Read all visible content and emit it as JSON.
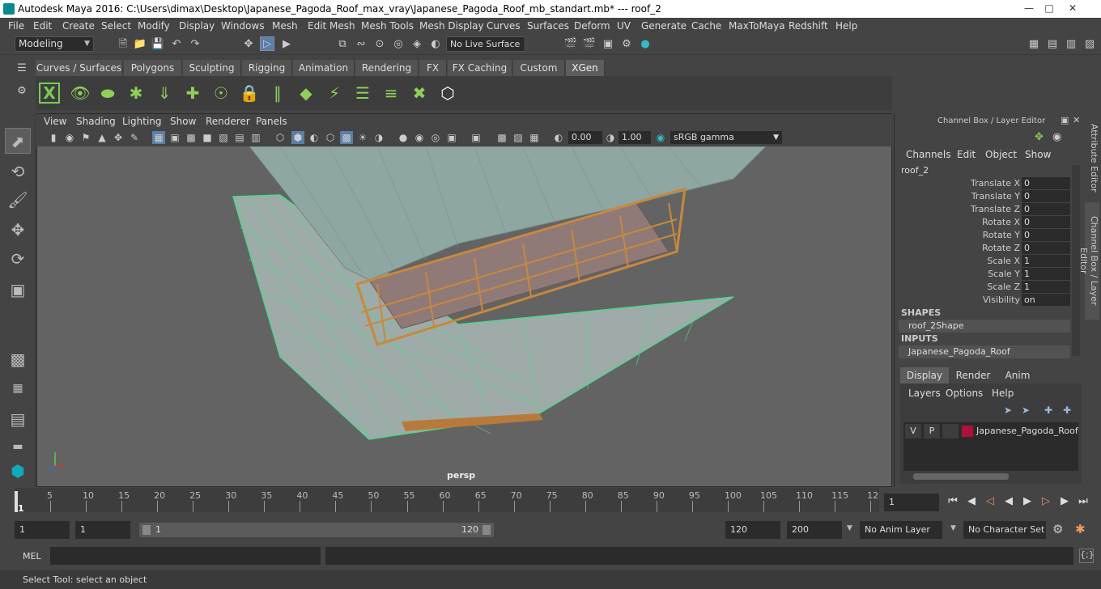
{
  "window": {
    "title": "Autodesk Maya 2016: C:\\Users\\dimax\\Desktop\\Japanese_Pagoda_Roof_max_vray\\Japanese_Pagoda_Roof_mb_standart.mb*   ---   roof_2"
  },
  "menubar": [
    "File",
    "Edit",
    "Create",
    "Select",
    "Modify",
    "Display",
    "Windows",
    "Mesh",
    "Edit Mesh",
    "Mesh Tools",
    "Mesh Display",
    "Curves",
    "Surfaces",
    "Deform",
    "UV",
    "Generate",
    "Cache",
    "MaxToMaya",
    "Redshift",
    "Help"
  ],
  "status": {
    "mode": "Modeling",
    "live_surface": "No Live Surface"
  },
  "shelf_tabs": [
    "Curves / Surfaces",
    "Polygons",
    "Sculpting",
    "Rigging",
    "Animation",
    "Rendering",
    "FX",
    "FX Caching",
    "Custom",
    "XGen"
  ],
  "shelf_active": "XGen",
  "viewport": {
    "menu": [
      "View",
      "Shading",
      "Lighting",
      "Show",
      "Renderer",
      "Panels"
    ],
    "exposure": "0.00",
    "gamma": "1.00",
    "colorspace": "sRGB gamma",
    "camera": "persp"
  },
  "channel_box": {
    "header": "Channel Box / Layer Editor",
    "menu": [
      "Channels",
      "Edit",
      "Object",
      "Show"
    ],
    "object": "roof_2",
    "channels": [
      {
        "label": "Translate X",
        "value": "0"
      },
      {
        "label": "Translate Y",
        "value": "0"
      },
      {
        "label": "Translate Z",
        "value": "0"
      },
      {
        "label": "Rotate X",
        "value": "0"
      },
      {
        "label": "Rotate Y",
        "value": "0"
      },
      {
        "label": "Rotate Z",
        "value": "0"
      },
      {
        "label": "Scale X",
        "value": "1"
      },
      {
        "label": "Scale Y",
        "value": "1"
      },
      {
        "label": "Scale Z",
        "value": "1"
      },
      {
        "label": "Visibility",
        "value": "on"
      }
    ],
    "shapes_label": "SHAPES",
    "shape": "roof_2Shape",
    "inputs_label": "INPUTS",
    "input": "Japanese_Pagoda_Roof"
  },
  "layer_editor": {
    "tabs": [
      "Display",
      "Render",
      "Anim"
    ],
    "menu": [
      "Layers",
      "Options",
      "Help"
    ],
    "layer": {
      "v": "V",
      "p": "P",
      "name": "Japanese_Pagoda_Roof",
      "color": "#b0103a"
    }
  },
  "side_tabs": [
    "Attribute Editor",
    "Channel Box / Layer Editor"
  ],
  "timeline": {
    "ticks": [
      "5",
      "10",
      "15",
      "20",
      "25",
      "30",
      "35",
      "40",
      "45",
      "50",
      "55",
      "60",
      "65",
      "70",
      "75",
      "80",
      "85",
      "90",
      "95",
      "100",
      "105",
      "110",
      "115",
      "12"
    ],
    "current_frame": "1",
    "frame_field": "1"
  },
  "range": {
    "start": "1",
    "start_inner": "1",
    "slider_start": "1",
    "slider_end": "120",
    "end_inner": "120",
    "end": "200",
    "anim_layer": "No Anim Layer",
    "character_set": "No Character Set"
  },
  "command": {
    "label": "MEL"
  },
  "help_line": "Select Tool: select an object"
}
